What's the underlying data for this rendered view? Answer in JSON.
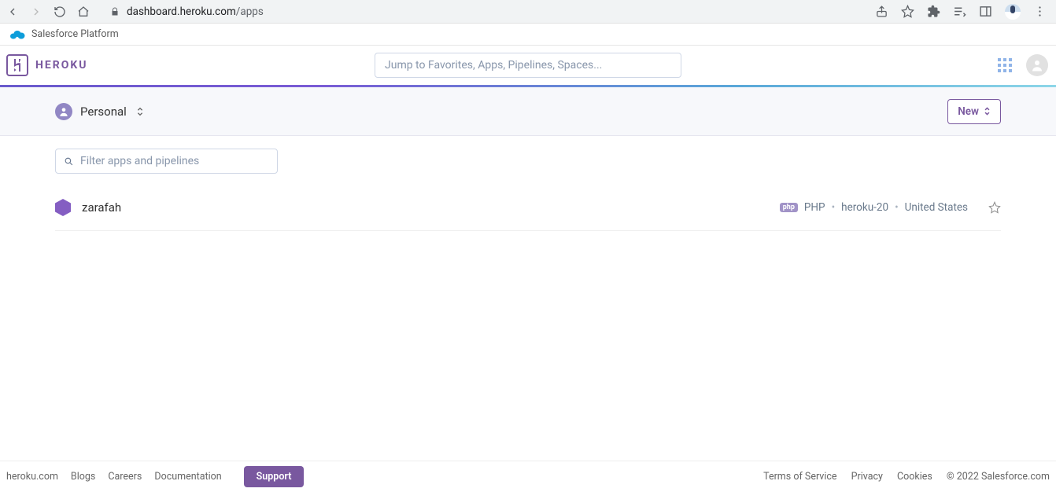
{
  "browser": {
    "url_host": "dashboard.heroku.com",
    "url_path": "/apps"
  },
  "salesforce_strip": "Salesforce Platform",
  "heroku": {
    "brand": "HEROKU",
    "search_placeholder": "Jump to Favorites, Apps, Pipelines, Spaces..."
  },
  "subheader": {
    "team": "Personal",
    "new_button": "New"
  },
  "filter_placeholder": "Filter apps and pipelines",
  "apps": [
    {
      "name": "zarafah",
      "lang": "PHP",
      "stack": "heroku-20",
      "region": "United States"
    }
  ],
  "footer": {
    "left": [
      "heroku.com",
      "Blogs",
      "Careers",
      "Documentation"
    ],
    "support": "Support",
    "right": [
      "Terms of Service",
      "Privacy",
      "Cookies"
    ],
    "copyright": "© 2022 Salesforce.com"
  }
}
